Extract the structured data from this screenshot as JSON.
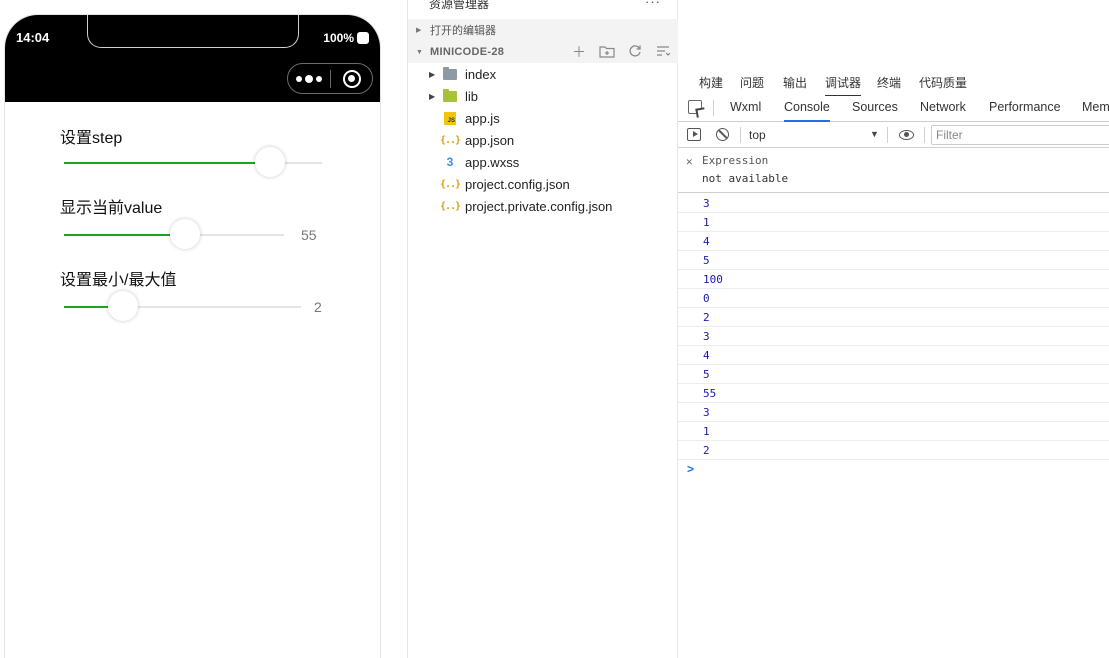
{
  "phone": {
    "status": {
      "time": "14:04",
      "battery": "100%"
    },
    "sliders": [
      {
        "title": "设置step",
        "value": 80,
        "min": 0,
        "max": 100,
        "show_value": false,
        "display": ""
      },
      {
        "title": "显示当前value",
        "value": 55,
        "min": 0,
        "max": 100,
        "show_value": true,
        "display": "55"
      },
      {
        "title": "设置最小/最大值",
        "value": 2,
        "min": 0,
        "max": 8,
        "show_value": true,
        "display": "2"
      }
    ],
    "accent_color": "#25a025"
  },
  "explorer": {
    "header": "资源管理器",
    "more": "···",
    "open_editors": "打开的编辑器",
    "project": "MINICODE-28",
    "tree": [
      {
        "name": "index",
        "icon": "folder-icon",
        "expandable": true
      },
      {
        "name": "lib",
        "icon": "folder-lib-icon",
        "expandable": true
      },
      {
        "name": "app.js",
        "icon": "js-file-icon",
        "expandable": false
      },
      {
        "name": "app.json",
        "icon": "json-file-icon",
        "expandable": false
      },
      {
        "name": "app.wxss",
        "icon": "css-file-icon",
        "expandable": false
      },
      {
        "name": "project.config.json",
        "icon": "json-file-icon",
        "expandable": false
      },
      {
        "name": "project.private.config.json",
        "icon": "json-file-icon",
        "expandable": false
      }
    ]
  },
  "debugger": {
    "top_tabs": [
      "构建",
      "问题",
      "输出",
      "调试器",
      "终端",
      "代码质量"
    ],
    "top_active": "调试器",
    "dev_tabs": [
      "Wxml",
      "Console",
      "Sources",
      "Network",
      "Performance",
      "Mem"
    ],
    "dev_active": "Console",
    "context": "top",
    "filter_placeholder": "Filter",
    "expression": {
      "label": "Expression",
      "value": "not available"
    },
    "logs": [
      "3",
      "1",
      "4",
      "5",
      "100",
      "0",
      "2",
      "3",
      "4",
      "5",
      "55",
      "3",
      "1",
      "2"
    ],
    "prompt": ">",
    "link_color": "#1a73e8"
  }
}
